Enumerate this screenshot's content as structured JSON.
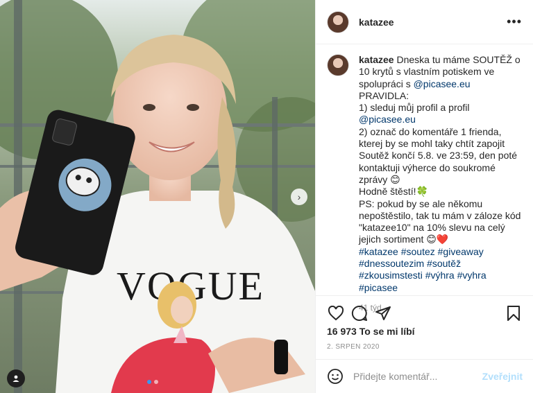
{
  "post": {
    "username": "katazee",
    "caption": {
      "username": "katazee",
      "lines": [
        {
          "text": "Dneska tu máme SOUTĚŽ o 10 krytů s vlastním potiskem ve spolupráci s ",
          "link": "@picasee.eu"
        },
        {
          "text": "PRAVIDLA:"
        },
        {
          "text": "1) sleduj můj profil a profil ",
          "link": "@picasee.eu"
        },
        {
          "text": "2) označ do komentáře 1 frienda, kterej by se mohl taky chtít zapojit"
        },
        {
          "text": "Soutěž končí 5.8. ve 23:59, den poté kontaktuji výherce do soukromé zprávy 😊"
        },
        {
          "text": "Hodně štěstí!🍀"
        },
        {
          "text": "PS: pokud by se ale někomu nepoštěstilo, tak tu mám v záloze kód \"katazee10\" na 10% slevu na celý jejich sortiment 😊❤️"
        }
      ],
      "hashtags": "#katazee #soutez #giveaway #dnessoutezim #soutěž #zkousimstesti #výhra #vyhra #picasee"
    },
    "relative_time": "41 týd.",
    "likes": "16 973 To se mi líbí",
    "date": "2. SRPEN 2020"
  },
  "comment_box": {
    "placeholder": "Přidejte komentář...",
    "post_label": "Zveřejnit"
  },
  "icons": {
    "more": "more-options-icon",
    "like": "heart-icon",
    "comment": "comment-icon",
    "share": "share-icon",
    "save": "bookmark-icon",
    "emoji": "emoji-icon",
    "next": "chevron-right-icon",
    "tags": "user-tag-icon"
  },
  "colors": {
    "link": "#00376b",
    "muted": "#8e8e8e",
    "post_button": "#b2dffc",
    "carousel_active": "#3897f0"
  }
}
